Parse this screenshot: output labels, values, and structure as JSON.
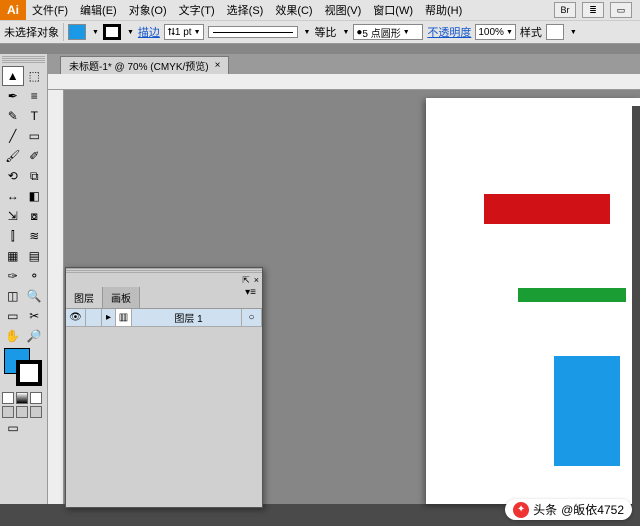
{
  "menubar": {
    "items": [
      "文件(F)",
      "编辑(E)",
      "对象(O)",
      "文字(T)",
      "选择(S)",
      "效果(C)",
      "视图(V)",
      "窗口(W)",
      "帮助(H)"
    ],
    "right_icons": [
      "Br",
      "≣",
      "▭"
    ]
  },
  "optbar": {
    "selection_status": "未选择对象",
    "fill_color": "#1a99e6",
    "stroke_toggle_title": "描边切换",
    "stroke_label": "描边",
    "stroke_weight": "1 pt",
    "proportion_label": "等比",
    "brush_label": "5 点圆形",
    "opacity_label": "不透明度",
    "opacity_value": "100%",
    "style_label": "样式"
  },
  "document": {
    "tab_title": "未标题-1* @ 70% (CMYK/预览)"
  },
  "tools": {
    "rows": [
      [
        "▲",
        "⬚"
      ],
      [
        "✒",
        "≡"
      ],
      [
        "✎",
        "T"
      ],
      [
        "╱",
        "▭"
      ],
      [
        "🖌",
        "✐"
      ],
      [
        "⟲",
        "⧉"
      ],
      [
        "↔",
        "◧"
      ],
      [
        "⇲",
        "⧇"
      ],
      [
        "⫿",
        "≋"
      ],
      [
        "▦",
        "▤"
      ],
      [
        "✑",
        "⚬"
      ],
      [
        "◫",
        "🔍"
      ],
      [
        "▭",
        "✂"
      ],
      [
        "✋",
        "🔎"
      ]
    ]
  },
  "fill_stroke": {
    "fill": "#1a99e6",
    "stroke": "#000000"
  },
  "panel": {
    "tabs": [
      "图层",
      "画板"
    ],
    "active_tab": 0,
    "layer": {
      "name": "图层 1"
    },
    "close_tip": "×",
    "collapse_tip": "⇱"
  },
  "artboard": {
    "shapes": [
      {
        "id": "red-rect",
        "color": "#d01217"
      },
      {
        "id": "green-rect",
        "color": "#1a9e34"
      },
      {
        "id": "blue-rect",
        "color": "#1a99e6"
      }
    ]
  },
  "watermark": {
    "prefix": "头条",
    "text": "@皈依4752"
  }
}
